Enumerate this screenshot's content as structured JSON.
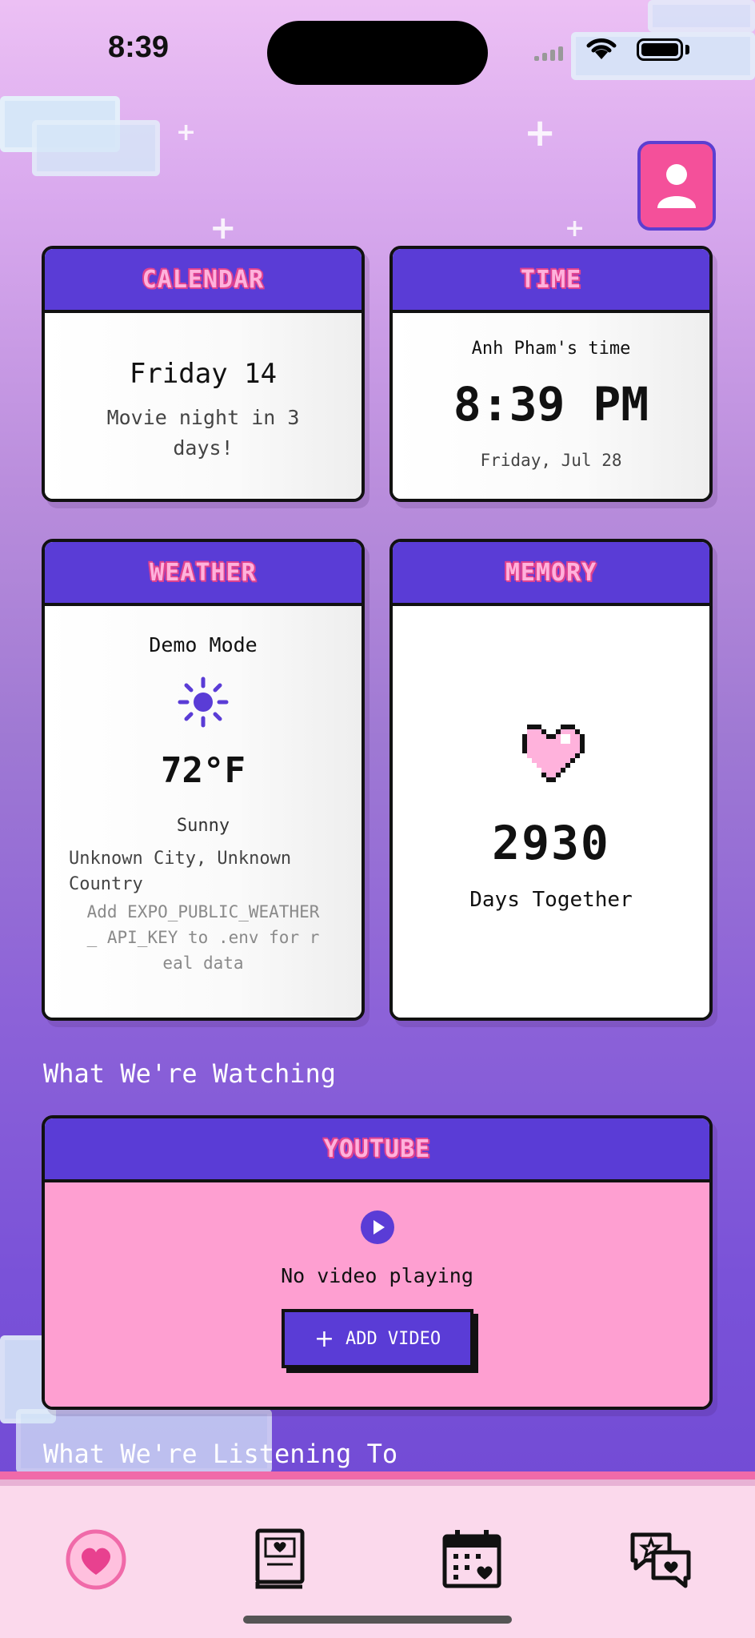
{
  "status": {
    "time": "8:39"
  },
  "cards": {
    "calendar": {
      "title": "CALENDAR",
      "date": "Friday 14",
      "event": "Movie night in 3 days!"
    },
    "time": {
      "title": "TIME",
      "owner": "Anh Pham's time",
      "clock": "8:39 PM",
      "date": "Friday, Jul 28"
    },
    "weather": {
      "title": "WEATHER",
      "mode": "Demo Mode",
      "temp": "72°F",
      "condition": "Sunny",
      "location": "Unknown City, Unknown Country",
      "hint": "Add EXPO_PUBLIC_WEATHER_ API_KEY to .env for real data"
    },
    "memory": {
      "title": "MEMORY",
      "count": "2930",
      "label": "Days Together"
    }
  },
  "sections": {
    "watching": "What We're Watching",
    "listening": "What We're Listening To"
  },
  "youtube": {
    "title": "YOUTUBE",
    "status": "No video playing",
    "add_label": "ADD VIDEO"
  },
  "colors": {
    "accent": "#5a3cd6",
    "pink": "#f4509a",
    "youtube_bg": "#fe9fd1"
  },
  "tabs": [
    "heart-icon",
    "book-icon",
    "calendar-icon",
    "chat-icon"
  ]
}
